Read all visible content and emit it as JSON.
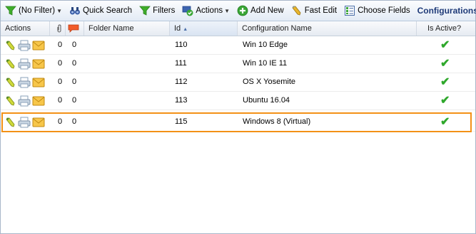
{
  "toolbar": {
    "filter_label": "(No Filter)",
    "quick_search_label": "Quick Search",
    "filters_label": "Filters",
    "actions_label": "Actions",
    "add_new_label": "Add New",
    "fast_edit_label": "Fast Edit",
    "choose_fields_label": "Choose Fields",
    "title": "Configurations"
  },
  "columns": {
    "actions": "Actions",
    "folder_name": "Folder Name",
    "id": "Id",
    "configuration_name": "Configuration Name",
    "is_active": "Is Active?"
  },
  "rows": [
    {
      "attachments": "0",
      "comments": "0",
      "folder": "",
      "id": "110",
      "name": "Win 10 Edge",
      "active": "✔"
    },
    {
      "attachments": "0",
      "comments": "0",
      "folder": "",
      "id": "111",
      "name": "Win 10 IE 11",
      "active": "✔"
    },
    {
      "attachments": "0",
      "comments": "0",
      "folder": "",
      "id": "112",
      "name": "OS X Yosemite",
      "active": "✔"
    },
    {
      "attachments": "0",
      "comments": "0",
      "folder": "",
      "id": "113",
      "name": "Ubuntu 16.04",
      "active": "✔"
    },
    {
      "attachments": "0",
      "comments": "0",
      "folder": "",
      "id": "115",
      "name": "Windows 8 (Virtual)",
      "active": "✔"
    }
  ],
  "colors": {
    "highlight": "#f39116",
    "title": "#1e3a78",
    "check": "#2fa82c"
  }
}
